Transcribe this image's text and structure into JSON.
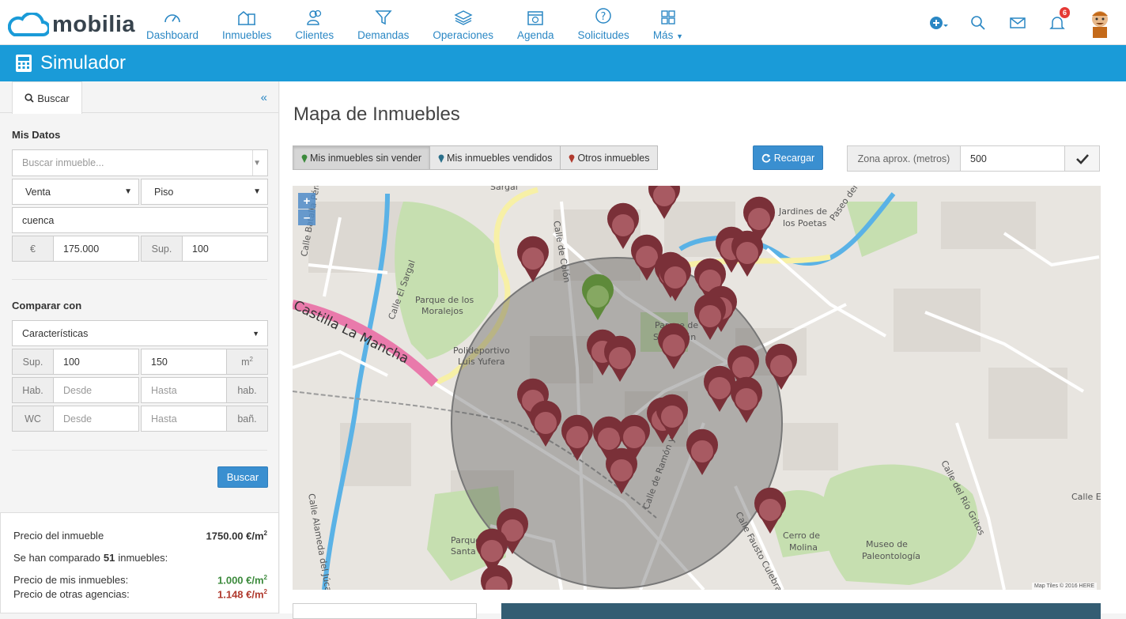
{
  "app": {
    "logo_text": "mobilia",
    "brand_color": "#1a9bd8"
  },
  "nav": [
    {
      "label": "Dashboard",
      "icon": "gauge-icon"
    },
    {
      "label": "Inmuebles",
      "icon": "building-icon"
    },
    {
      "label": "Clientes",
      "icon": "users-icon"
    },
    {
      "label": "Demandas",
      "icon": "filter-icon"
    },
    {
      "label": "Operaciones",
      "icon": "stack-icon"
    },
    {
      "label": "Agenda",
      "icon": "calendar-icon"
    },
    {
      "label": "Solicitudes",
      "icon": "question-icon"
    },
    {
      "label": "Más",
      "icon": "grid-icon"
    }
  ],
  "notifications": {
    "count": "6"
  },
  "page": {
    "title": "Simulador"
  },
  "sidebar": {
    "tab_label": "Buscar",
    "collapse_label": "«",
    "mis_datos_title": "Mis Datos",
    "search_placeholder": "Buscar inmueble...",
    "operation": "Venta",
    "type": "Piso",
    "city": "cuenca",
    "price_addon": "€",
    "price": "175.000",
    "surface_addon": "Sup.",
    "surface": "100",
    "comparar_title": "Comparar con",
    "compare_by": "Características",
    "sup_label": "Sup.",
    "sup_from": "100",
    "sup_to": "150",
    "sup_unit": "m2",
    "hab_label": "Hab.",
    "hab_from_ph": "Desde",
    "hab_to_ph": "Hasta",
    "hab_unit": "hab.",
    "wc_label": "WC",
    "wc_from_ph": "Desde",
    "wc_to_ph": "Hasta",
    "wc_unit": "bañ.",
    "search_button": "Buscar"
  },
  "results": {
    "price_label": "Precio del inmueble",
    "price_value": "1750.00 €/m2",
    "compared_pre": "Se han comparado",
    "compared_count": "51",
    "compared_post": "inmuebles:",
    "mine_label": "Precio de mis inmuebles:",
    "mine_value": "1.000 €/m2",
    "others_label": "Precio de otras agencias:",
    "others_value": "1.148 €/m2",
    "mine_color": "#3c8a3c",
    "others_color": "#b03a2e"
  },
  "main": {
    "title": "Mapa de Inmuebles",
    "filters": [
      "Mis inmuebles sin vender",
      "Mis inmuebles vendidos",
      "Otros inmuebles"
    ],
    "reload_label": "Recargar",
    "zona_label": "Zona aprox. (metros)",
    "zona_value": "500"
  },
  "map": {
    "labels": [
      "Jardines de",
      "los Poetas",
      "Paseo del",
      "Parque de los",
      "Moralejos",
      "Calle El Sargal",
      "Polideportivo",
      "Luis Yufera",
      "Calle de Colón",
      "Parque de",
      "San Julián",
      "Castilla La Mancha",
      "Calle de Ramón y Cajal",
      "Calle del Río Gritos",
      "Calle E",
      "Cerro de",
      "Molina",
      "Museo de",
      "Paleontología",
      "Calle Fausto Culebras",
      "Calle Alameda del Júcar",
      "Parque",
      "Santa",
      "Calle Batalla Pérez",
      "Sargal"
    ],
    "attribution": "Map Tiles © 2016 HERE",
    "zoom_in": "+",
    "zoom_out": "–"
  }
}
